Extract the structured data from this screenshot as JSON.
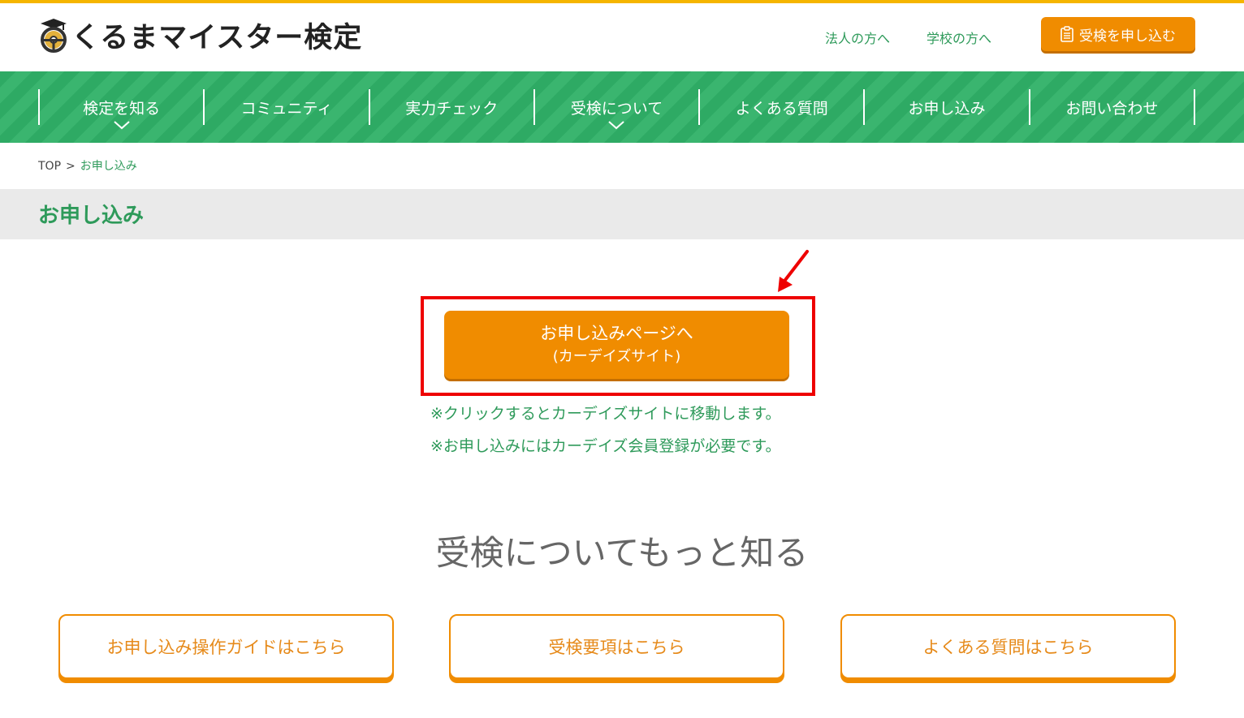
{
  "header": {
    "logo_text": "くるまマイスター検定",
    "links": [
      "法人の方へ",
      "学校の方へ"
    ],
    "apply_button": "受検を申し込む"
  },
  "nav": {
    "items": [
      {
        "label": "検定を知る",
        "has_dropdown": true
      },
      {
        "label": "コミュニティ",
        "has_dropdown": false
      },
      {
        "label": "実力チェック",
        "has_dropdown": false
      },
      {
        "label": "受検について",
        "has_dropdown": true
      },
      {
        "label": "よくある質問",
        "has_dropdown": false
      },
      {
        "label": "お申し込み",
        "has_dropdown": false
      },
      {
        "label": "お問い合わせ",
        "has_dropdown": false
      }
    ]
  },
  "breadcrumb": {
    "root": "TOP",
    "separator": ">",
    "current": "お申し込み"
  },
  "page": {
    "title": "お申し込み",
    "cta_line1": "お申し込みページへ",
    "cta_line2": "(カーデイズサイト)",
    "notes": [
      "※クリックするとカーデイズサイトに移動します。",
      "※お申し込みにはカーデイズ会員登録が必要です。"
    ],
    "section_heading": "受検についてもっと知る",
    "link_cards": [
      "お申し込み操作ガイドはこちら",
      "受検要項はこちら",
      "よくある質問はこちら"
    ]
  },
  "colors": {
    "brand_green": "#2eaa64",
    "accent_orange": "#f08c00",
    "top_bar_yellow": "#f5b500",
    "highlight_red": "#ee0000"
  },
  "icons": {
    "logo": "steering-wheel-icon",
    "apply": "clipboard-icon",
    "dropdown": "chevron-down-icon",
    "annotation": "red-arrow-icon"
  }
}
